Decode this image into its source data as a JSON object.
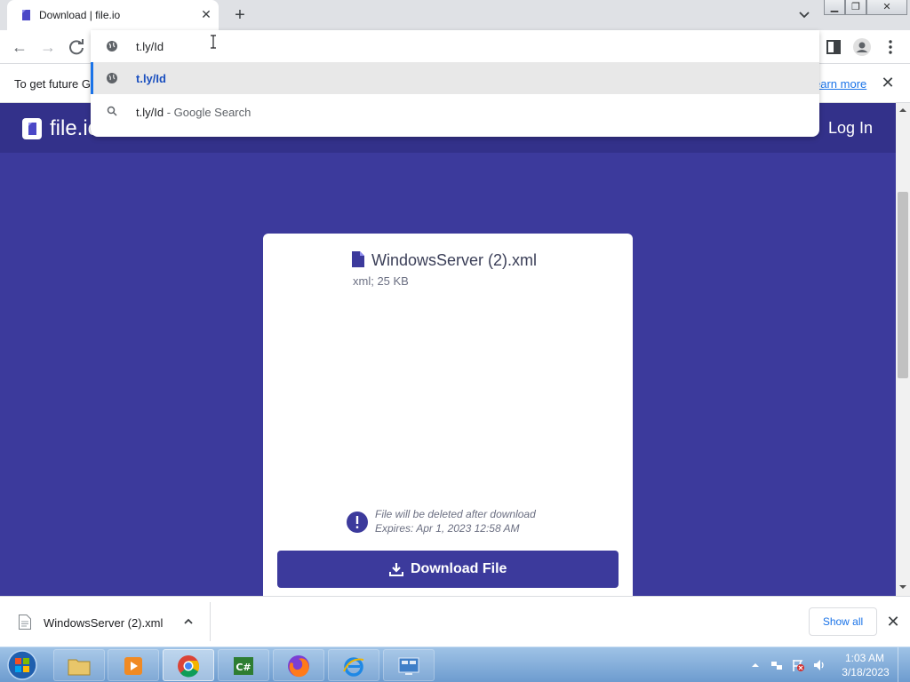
{
  "tab": {
    "title": "Download | file.io",
    "favicon": "fileio-favicon-icon"
  },
  "toolbar": {
    "reload_icon": "reload-icon"
  },
  "omnibox": {
    "input_value": "t.ly/Id",
    "suggestion_url": "t.ly/Id",
    "search_query": "t.ly/Id",
    "search_separator": " - ",
    "search_engine_label": "Google Search"
  },
  "infobar": {
    "text": "To get future G",
    "link": "earn more"
  },
  "site": {
    "logo": "file.io",
    "login": "Log In"
  },
  "file": {
    "name": "WindowsServer (2).xml",
    "meta": "xml; 25 KB",
    "warning_line1": "File will be deleted after download",
    "warning_line2": "Expires: Apr 1, 2023 12:58 AM",
    "download_label": "Download File"
  },
  "download_bar": {
    "file_name": "WindowsServer (2).xml",
    "show_all": "Show all"
  },
  "clock": {
    "time": "1:03 AM",
    "date": "3/18/2023"
  },
  "colors": {
    "brand": "#3c3a9c",
    "header": "#33318a",
    "link": "#1a73e8"
  }
}
